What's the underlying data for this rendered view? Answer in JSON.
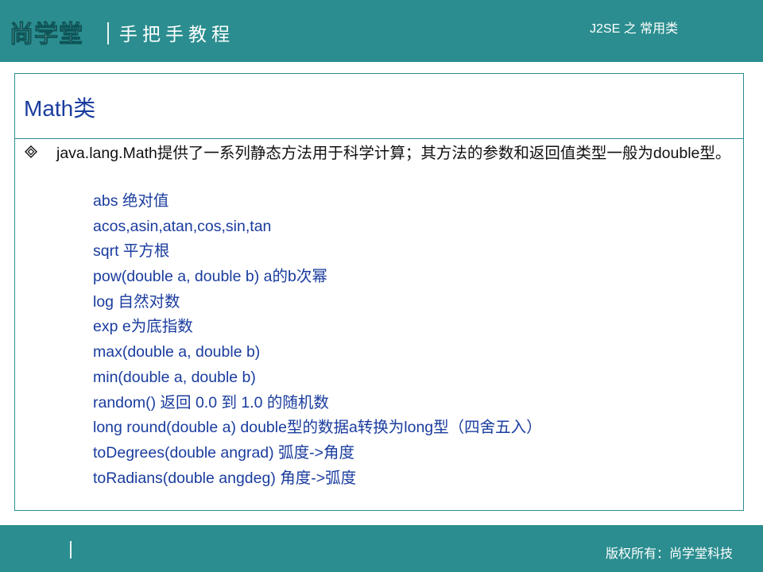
{
  "header": {
    "logo_text": "尚学堂",
    "subtitle": "手把手教程",
    "course": "J2SE 之 常用类"
  },
  "slide": {
    "title": "Math类",
    "bullet_icon": "diamond-bullet-icon",
    "lead": "java.lang.Math提供了一系列静态方法用于科学计算；其方法的参数和返回值类型一般为double型。",
    "items": [
      "abs 绝对值",
      "acos,asin,atan,cos,sin,tan",
      "sqrt 平方根",
      "pow(double a, double b) a的b次幂",
      "log 自然对数",
      "exp e为底指数",
      "max(double a, double b)",
      "min(double a, double b)",
      "random() 返回 0.0 到 1.0 的随机数",
      "long round(double a) double型的数据a转换为long型（四舍五入）",
      "toDegrees(double angrad) 弧度->角度",
      "toRadians(double angdeg) 角度->弧度"
    ]
  },
  "footer": {
    "copyright": "版权所有：尚学堂科技"
  },
  "colors": {
    "brand_teal": "#2b8d8f",
    "title_blue": "#1a3c9e",
    "item_blue": "#1a3c9e"
  }
}
